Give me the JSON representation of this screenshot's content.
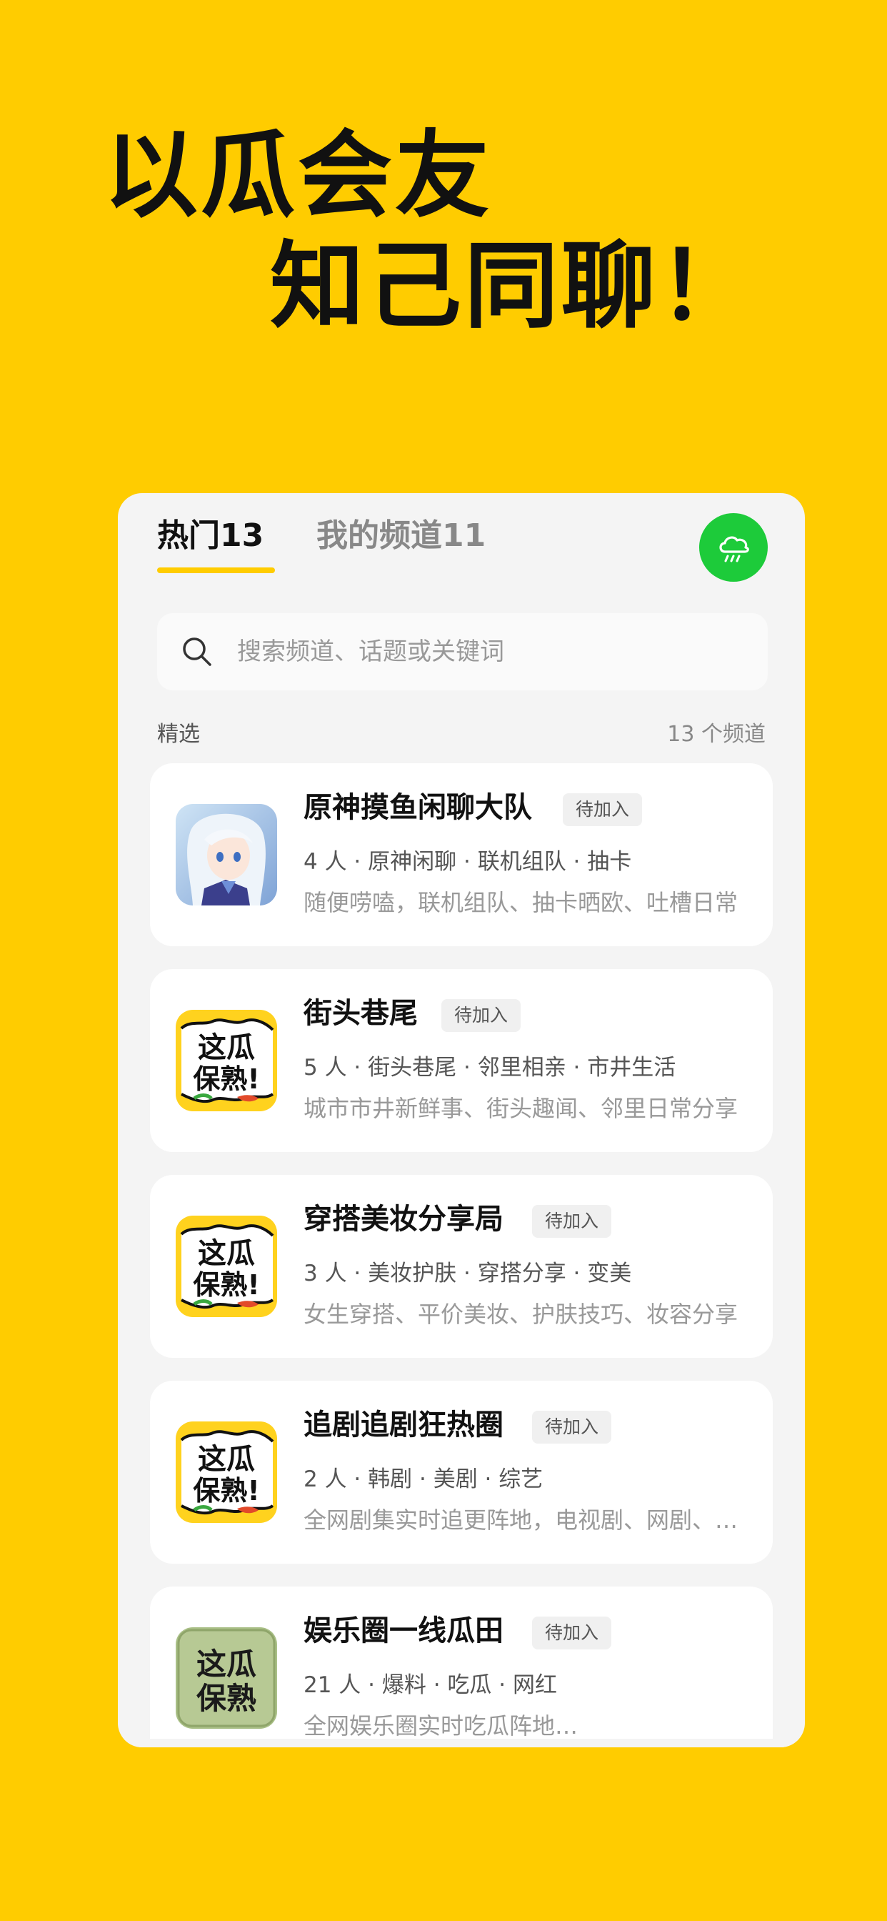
{
  "hero": {
    "line1": "以瓜会友",
    "line2": "知己同聊！"
  },
  "tabs": [
    {
      "label": "热门13",
      "active": true
    },
    {
      "label": "我的频道11",
      "active": false
    }
  ],
  "weather_button": {
    "icon": "rain-cloud-icon",
    "color": "#1DCB3A"
  },
  "search": {
    "placeholder": "搜索频道、话题或关键词",
    "value": ""
  },
  "section": {
    "label": "精选",
    "count": "13 个频道"
  },
  "channels": [
    {
      "title": "原神摸鱼闲聊大队",
      "status": "待加入",
      "tags": "4 人 · 原神闲聊 · 联机组队 · 抽卡",
      "desc": "随便唠嗑，联机组队、抽卡晒欧、吐槽日常",
      "avatar": "anime-character"
    },
    {
      "title": "街头巷尾",
      "status": "待加入",
      "tags": "5 人 · 街头巷尾 · 邻里相亲 · 市井生活",
      "desc": "城市市井新鲜事、街头趣闻、邻里日常分享",
      "avatar": "logo",
      "logo_text": [
        "这瓜",
        "保熟!"
      ]
    },
    {
      "title": "穿搭美妆分享局",
      "status": "待加入",
      "tags": "3 人 · 美妆护肤 · 穿搭分享 · 变美",
      "desc": "女生穿搭、平价美妆、护肤技巧、妆容分享",
      "avatar": "logo",
      "logo_text": [
        "这瓜",
        "保熟!"
      ]
    },
    {
      "title": "追剧追剧狂热圈",
      "status": "待加入",
      "tags": "2 人 · 韩剧 · 美剧 · 综艺",
      "desc": "全网剧集实时追更阵地，电视剧、网剧、综艺",
      "avatar": "logo",
      "logo_text": [
        "这瓜",
        "保熟!"
      ]
    },
    {
      "title": "娱乐圈一线瓜田",
      "status": "待加入",
      "tags": "21 人 · 爆料 · 吃瓜 · 网红",
      "desc": "全网娱乐圈实时吃瓜阵地…",
      "avatar": "logo-green",
      "logo_text": [
        "这瓜",
        "保熟"
      ]
    }
  ]
}
